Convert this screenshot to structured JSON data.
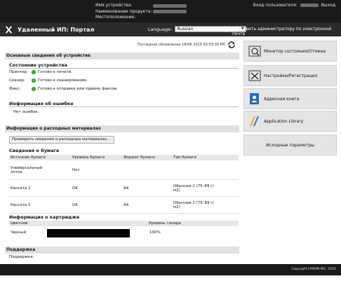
{
  "header": {
    "device_name_label": "Имя устройства:",
    "product_name_label": "Наименование продукта:",
    "location_label": "Местоположение:",
    "login_label": "Вход пользователя:",
    "logout_label": "Выход"
  },
  "navbar": {
    "title": "Удаленный ИП: Портал",
    "language_label": "Language:",
    "language_value": "Russian",
    "email_link": "Отправить администратору по электронной почте"
  },
  "main": {
    "last_updated": "Последнее обновление 18/06 2025 02:59:30 PM",
    "basic_info_title": "Основные сведения об устройстве",
    "device_status": {
      "title": "Состояние устройства",
      "rows": [
        {
          "label": "Принтер:",
          "value": "Готово к печати."
        },
        {
          "label": "Сканер:",
          "value": "Готово к сканированию."
        },
        {
          "label": "Факс:",
          "value": "Готово к отправке или приему факсов."
        }
      ]
    },
    "error_info": {
      "title": "Информация об ошибке",
      "value": "Нет ошибок."
    },
    "consumables_title": "Информация о расходных материалах",
    "check_button": "Проверить сведения о расходных материалах...",
    "paper_info": {
      "title": "Сведения о бумаге",
      "headers": [
        "Источник бумаги",
        "Уровень бумаги",
        "Формат бумаги",
        "Тип бумаги"
      ],
      "rows": [
        [
          "Универсальный лоток",
          "Нет",
          "",
          ""
        ],
        [
          "Кассета 1",
          "OK",
          "A4",
          "Обычная 2 (75–89 г/м2)"
        ],
        [
          "Кассета 2",
          "OK",
          "A4",
          "Обычная 2 (75–89 г/м2)"
        ]
      ]
    },
    "cartridge_info": {
      "title": "Информация о картридже",
      "headers": [
        "Цветной",
        "Уровень тонера"
      ],
      "row": {
        "color": "Черный",
        "level": "100%"
      },
      "toner_level": 1.0
    },
    "support_title": "Поддержка",
    "support_label": "Поддержка:"
  },
  "sidebar": {
    "items": [
      {
        "label": "Монитор состояния/Отмена",
        "icon": "status-monitor-icon"
      },
      {
        "label": "Настройки/Регистрация",
        "icon": "settings-icon"
      },
      {
        "label": "Адресная книга",
        "icon": "address-book-icon"
      },
      {
        "label": "Application Library",
        "icon": "app-library-icon"
      },
      {
        "label": "Исходные параметры",
        "icon": ""
      }
    ]
  },
  "footer": {
    "copyright": "Copyright CANON INC. 2025"
  },
  "colors": {
    "ready_green": "#3cb93c",
    "header_bg": "#1a1a1a",
    "section_gray": "#e0e0e0"
  }
}
